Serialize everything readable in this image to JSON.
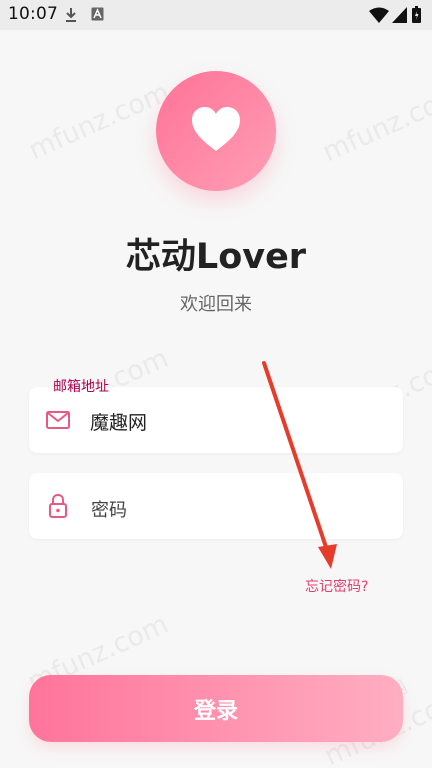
{
  "status_bar": {
    "time": "10:07",
    "icons": [
      "download-icon",
      "a-icon",
      "wifi-icon",
      "signal-icon",
      "battery-icon"
    ]
  },
  "app": {
    "title": "芯动Lover",
    "subtitle": "欢迎回来"
  },
  "email": {
    "label": "邮箱地址",
    "value": "魔趣网",
    "icon": "mail-icon"
  },
  "password": {
    "placeholder": "密码",
    "icon": "lock-icon"
  },
  "forgot_password": "忘记密码?",
  "login_button": "登录",
  "watermark": {
    "latin": "mfunz.com",
    "chinese": "魔趣网"
  },
  "colors": {
    "accent": "#ff7297",
    "accent_light": "#ffaec2",
    "label": "#b0004e",
    "link": "#e33e70",
    "annotation_arrow": "#e53d2a"
  }
}
